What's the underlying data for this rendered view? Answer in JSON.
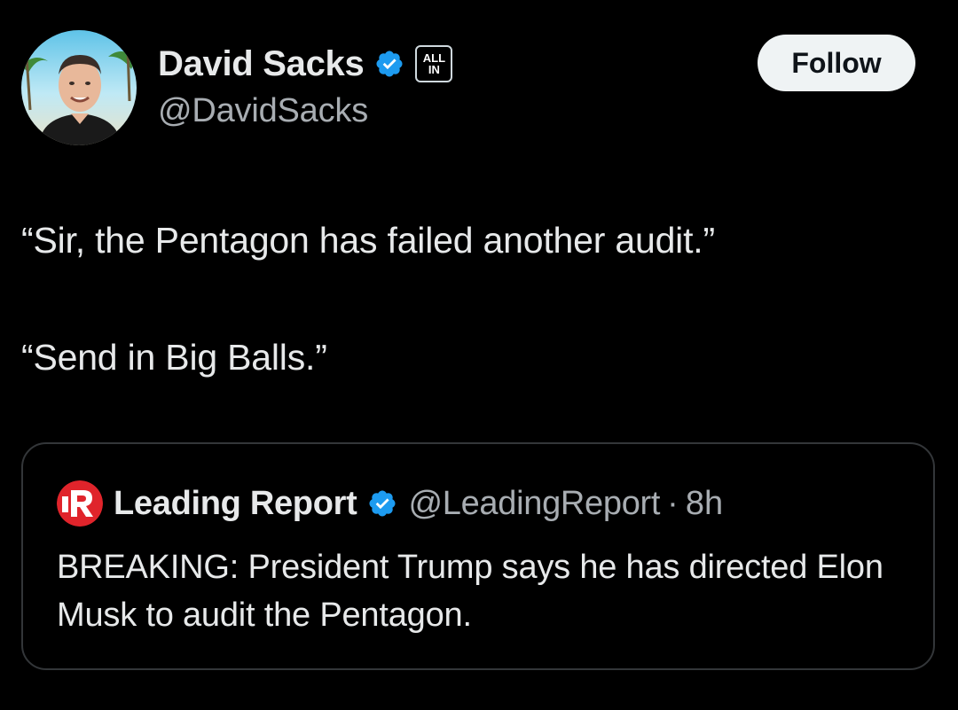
{
  "author": {
    "name": "David Sacks",
    "handle": "@DavidSacks",
    "verified_icon": "verified-badge-icon",
    "affiliate_badge": {
      "line1": "ALL",
      "line2": "IN"
    },
    "avatar_icon": "profile-photo"
  },
  "follow_button": {
    "label": "Follow"
  },
  "tweet": {
    "lines": [
      "“Sir, the Pentagon has failed another audit.”",
      "“Send in Big Balls.”"
    ]
  },
  "quoted_tweet": {
    "name": "Leading Report",
    "handle": "@LeadingReport",
    "separator": "·",
    "time": "8h",
    "logo_icon": "leading-report-logo",
    "verified_icon": "verified-badge-icon",
    "body": "BREAKING: President Trump says he has directed Elon Musk to audit the Pentagon."
  },
  "colors": {
    "background": "#000000",
    "text_primary": "#e7e9ea",
    "text_secondary": "#a8adb2",
    "verified_blue": "#1d9bf0",
    "card_border": "#333639",
    "follow_bg": "#eff3f4",
    "logo_red": "#e0242b"
  }
}
